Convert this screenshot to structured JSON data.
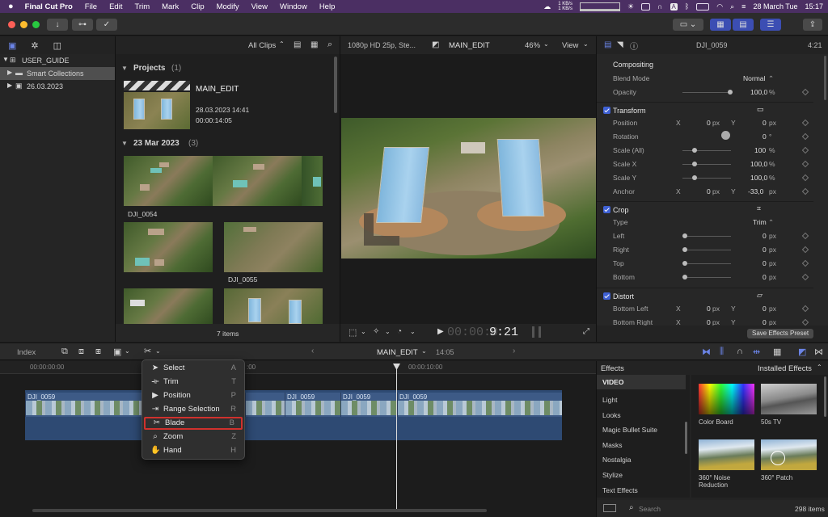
{
  "menubar": {
    "app": "Final Cut Pro",
    "items": [
      "File",
      "Edit",
      "Trim",
      "Mark",
      "Clip",
      "Modify",
      "View",
      "Window",
      "Help"
    ],
    "net_up": "1 KB/s",
    "net_down": "1 KB/s",
    "date": "28 March Tue",
    "time": "15:17"
  },
  "browser": {
    "library": "USER_GUIDE",
    "smart_collections": "Smart Collections",
    "event": "26.03.2023",
    "filter": "All Clips",
    "projects_header": "Projects",
    "projects_count": "(1)",
    "project_name": "MAIN_EDIT",
    "project_date": "28.03.2023 14:41",
    "project_duration": "00:00:14:05",
    "group_header": "23 Mar 2023",
    "group_count": "(3)",
    "clips": [
      "DJI_0054",
      "DJI_0055"
    ],
    "item_count": "7 items"
  },
  "viewer": {
    "format": "1080p HD 25p, Ste...",
    "project": "MAIN_EDIT",
    "zoom": "46%",
    "view_label": "View",
    "timecode_dim": "00:00:0",
    "timecode": "9:21"
  },
  "inspector": {
    "clip_name": "DJI_0059",
    "duration": "4:21",
    "compositing": "Compositing",
    "blend_mode_label": "Blend Mode",
    "blend_mode": "Normal",
    "opacity_label": "Opacity",
    "opacity": "100,0",
    "pct": "%",
    "transform": "Transform",
    "position_label": "Position",
    "x": "X",
    "y": "Y",
    "px": "px",
    "pos_x": "0",
    "pos_y": "0",
    "rotation_label": "Rotation",
    "rotation": "0",
    "deg": "°",
    "scale_all_label": "Scale (All)",
    "scale_all": "100",
    "scale_x_label": "Scale X",
    "scale_x": "100,0",
    "scale_y_label": "Scale Y",
    "scale_y": "100,0",
    "anchor_label": "Anchor",
    "anchor_x": "0",
    "anchor_y": "-33,0",
    "crop": "Crop",
    "type_label": "Type",
    "type": "Trim",
    "left_label": "Left",
    "left": "0",
    "right_label": "Right",
    "right": "0",
    "top_label": "Top",
    "top": "0",
    "bottom_label": "Bottom",
    "bottom": "0",
    "distort": "Distort",
    "bottom_left_label": "Bottom Left",
    "bl_x": "0",
    "bl_y": "0",
    "bottom_right_label": "Bottom Right",
    "br_x": "0",
    "br_y": "0",
    "save_preset": "Save Effects Preset"
  },
  "timeline": {
    "index": "Index",
    "project": "MAIN_EDIT",
    "duration": "14:05",
    "ruler_start": "00:00:00:00",
    "ruler_mid": ":00",
    "ruler_10": "00:00:10:00",
    "clip_names": [
      "DJI_0059",
      "DJI_0059",
      "DJI_0059",
      "DJI_0059"
    ]
  },
  "tool_menu": {
    "items": [
      {
        "label": "Select",
        "key": "A"
      },
      {
        "label": "Trim",
        "key": "T"
      },
      {
        "label": "Position",
        "key": "P"
      },
      {
        "label": "Range Selection",
        "key": "R"
      },
      {
        "label": "Blade",
        "key": "B"
      },
      {
        "label": "Zoom",
        "key": "Z"
      },
      {
        "label": "Hand",
        "key": "H"
      }
    ]
  },
  "effects": {
    "title": "Effects",
    "installed": "Installed Effects",
    "category_header": "VIDEO",
    "categories": [
      "Light",
      "Looks",
      "Magic Bullet Suite",
      "Masks",
      "Nostalgia",
      "Stylize",
      "Text Effects"
    ],
    "thumbs": [
      "Color Board",
      "50s TV",
      "360° Noise Reduction",
      "360° Patch"
    ],
    "search_placeholder": "Search",
    "count": "298 items"
  },
  "colors": {
    "menubar": "#4b2f63",
    "accent_blue": "#3f61d4",
    "clip": "#3d5a86",
    "highlight": "#d0312d"
  }
}
